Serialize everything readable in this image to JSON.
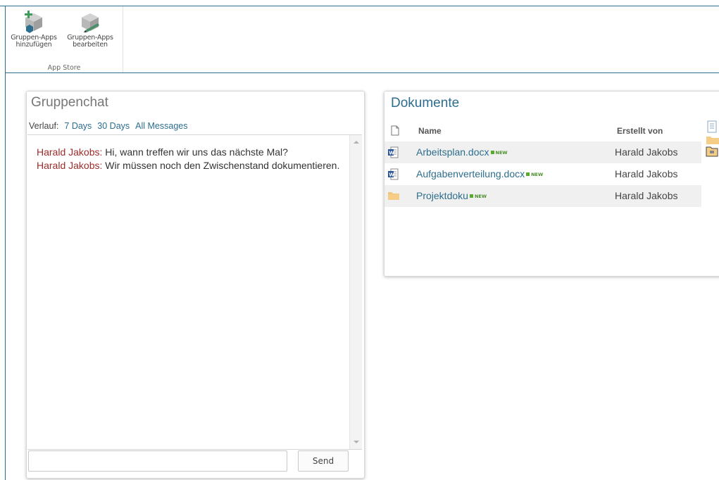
{
  "ribbon": {
    "add_label": "Gruppen-Apps\nhinzufügen",
    "edit_label": "Gruppen-Apps\nbearbeiten",
    "group_label": "App Store"
  },
  "chat": {
    "title": "Gruppenchat",
    "history_label": "Verlauf:",
    "filters": [
      "7 Days",
      "30 Days",
      "All Messages"
    ],
    "messages": [
      {
        "author": "Harald Jakobs:",
        "text": " Hi, wann treffen wir uns das nächste Mal?"
      },
      {
        "author": "Harald Jakobs:",
        "text": " Wir müssen noch den Zwischenstand dokumentieren."
      }
    ],
    "input_value": "",
    "send_label": "Send"
  },
  "docs": {
    "title": "Dokumente",
    "col_name": "Name",
    "col_created_by": "Erstellt von",
    "new_tag": "NEW",
    "rows": [
      {
        "name": "Arbeitsplan.docx",
        "created_by": "Harald Jakobs",
        "icon": "word-doc-icon"
      },
      {
        "name": "Aufgabenverteilung.docx",
        "created_by": "Harald Jakobs",
        "icon": "word-doc-icon"
      },
      {
        "name": "Projektdoku",
        "created_by": "Harald Jakobs",
        "icon": "folder-icon"
      }
    ]
  },
  "colors": {
    "accent": "#2d6e8e",
    "author": "#9e2b2b",
    "new_badge": "#5aab2c"
  }
}
